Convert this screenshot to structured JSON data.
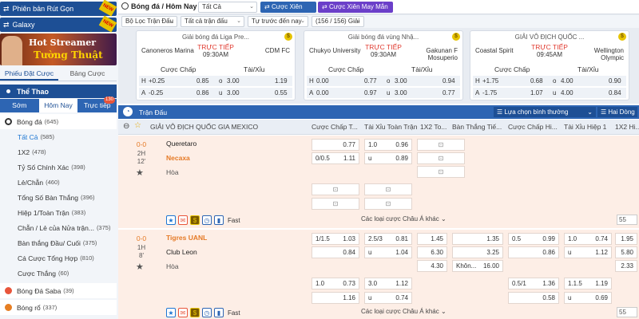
{
  "sidebar": {
    "promo_buttons": [
      {
        "label": "Phiên bản Rút Gọn",
        "badge": "NEW"
      },
      {
        "label": "Galaxy",
        "badge": "NEW"
      }
    ],
    "banner": {
      "line1": "Hot Streamer",
      "line2": "Tường Thuật"
    },
    "bet_tabs": [
      "Phiếu Đặt Cược",
      "Bảng Cược"
    ],
    "section_title": "Thể Thao",
    "time_tabs": [
      {
        "label": "Sớm"
      },
      {
        "label": "Hôm Nay"
      },
      {
        "label": "Trực tiếp",
        "count": "130"
      }
    ],
    "sport": {
      "label": "Bóng đá",
      "count": "(645)"
    },
    "sub_items": [
      {
        "label": "Tất Cả",
        "count": "(585)"
      },
      {
        "label": "1X2",
        "count": "(478)"
      },
      {
        "label": "Tỷ Số Chính Xác",
        "count": "(398)"
      },
      {
        "label": "Lẻ/Chẵn",
        "count": "(460)"
      },
      {
        "label": "Tổng Số Bàn Thắng",
        "count": "(396)"
      },
      {
        "label": "Hiệp 1/Toàn Trận",
        "count": "(383)"
      },
      {
        "label": "Chẵn / Lẻ của Nửa trận...",
        "count": "(375)"
      },
      {
        "label": "Bàn thắng Đầu/ Cuối",
        "count": "(375)"
      },
      {
        "label": "Cá Cược Tổng Hợp",
        "count": "(810)"
      },
      {
        "label": "Cược Thắng",
        "count": "(60)"
      }
    ],
    "other_sports": [
      {
        "label": "Bóng Đá Saba",
        "count": "(39)"
      },
      {
        "label": "Bóng rổ",
        "count": "(337)"
      }
    ]
  },
  "toolbar": {
    "breadcrumb": "Bóng đá / Hôm Nay",
    "filter_all": "Tất Cả",
    "cuoc_xien": "Cược Xiên",
    "cuoc_xien_may_man": "Cược Xiên May Mắn",
    "filter_matches": "Bộ Lọc Trận Đấu",
    "filter_markets": "Tất cả trận đấu",
    "sort": "Tự trước đến nay",
    "count": "(156 / 156) Giải"
  },
  "cards": [
    {
      "league": "Giải bóng đá Liga Pre...",
      "home": "Canoneros Marina",
      "away": "CDM FC",
      "live": "TRỰC TIẾP",
      "time": "09:30AM",
      "h1": "Cược Chấp",
      "h2": "Tài/Xỉu",
      "rows": [
        [
          "H",
          "+0.25",
          "0.85",
          "o",
          "3.00",
          "1.19"
        ],
        [
          "A",
          "-0.25",
          "0.86",
          "u",
          "3.00",
          "0.55"
        ]
      ]
    },
    {
      "league": "Giải bóng đá vùng Nhậ...",
      "home": "Chukyo University",
      "away": "Gakunan F Mosuperio",
      "live": "TRỰC TIẾP",
      "time": "09:30AM",
      "h1": "Cược Chấp",
      "h2": "Tài/Xỉu",
      "rows": [
        [
          "H",
          "0.00",
          "0.77",
          "o",
          "3.00",
          "0.94"
        ],
        [
          "A",
          "0.00",
          "0.97",
          "u",
          "3.00",
          "0.77"
        ]
      ]
    },
    {
      "league": "GIẢI VÔ ĐỊCH QUỐC ...",
      "home": "Coastal Spirit",
      "away": "Wellington Olympic",
      "live": "TRỰC TIẾP",
      "time": "09:45AM",
      "h1": "Cược Chấp",
      "h2": "Tài/Xỉu",
      "rows": [
        [
          "H",
          "+1.75",
          "0.68",
          "o",
          "4.00",
          "0.90"
        ],
        [
          "A",
          "-1.75",
          "1.07",
          "u",
          "4.00",
          "0.84"
        ]
      ]
    }
  ],
  "main": {
    "section": "Trận Đấu",
    "choose_league": "Lựa chọn bình thường",
    "view": "Hai Dòng",
    "league": "GIẢI VÔ ĐỊCH QUỐC GIA MEXICO",
    "columns": [
      "Cược Chấp T...",
      "Tài Xỉu Toàn Trận",
      "1X2 To...",
      "Bàn Thắng Tiế...",
      "Cược Chấp Hi...",
      "Tài Xỉu Hiệp 1",
      "1X2 Hi..."
    ],
    "more_label": "Các loại cược Châu Á khác",
    "fast": "Fast",
    "matches": [
      {
        "score": "0-0",
        "period": "2H",
        "minute": "12'",
        "home": "Queretaro",
        "away": "Necaxa",
        "draw": "Hòa",
        "count": "55",
        "r1": [
          "",
          "0.77",
          "1.0",
          "0.96"
        ],
        "r2": [
          "0/0.5",
          "1.11",
          "u",
          "0.89"
        ],
        "r4": [],
        "extra": []
      },
      {
        "score": "0-0",
        "period": "1H",
        "minute": "8'",
        "home": "Tigres UANL",
        "away": "Club Leon",
        "draw": "Hòa",
        "count": "55",
        "r1": [
          "1/1.5",
          "1.03",
          "2.5/3",
          "0.81",
          "1.45",
          "",
          "1.35",
          "0.5",
          "0.99",
          "1.0",
          "0.74",
          "1.95"
        ],
        "r2": [
          "",
          "0.84",
          "u",
          "1.04",
          "6.30",
          "",
          "3.25",
          "",
          "0.86",
          "u",
          "1.12",
          "5.80"
        ],
        "r3": [
          "4.30",
          "Khôn...",
          "16.00",
          "2.33"
        ],
        "r4": [
          "1.0",
          "0.73",
          "3.0",
          "1.12",
          "0.5/1",
          "1.36",
          "1.1.5",
          "1.19"
        ],
        "r5": [
          "",
          "1.16",
          "u",
          "0.74",
          "",
          "0.58",
          "u",
          "0.69"
        ]
      }
    ]
  }
}
